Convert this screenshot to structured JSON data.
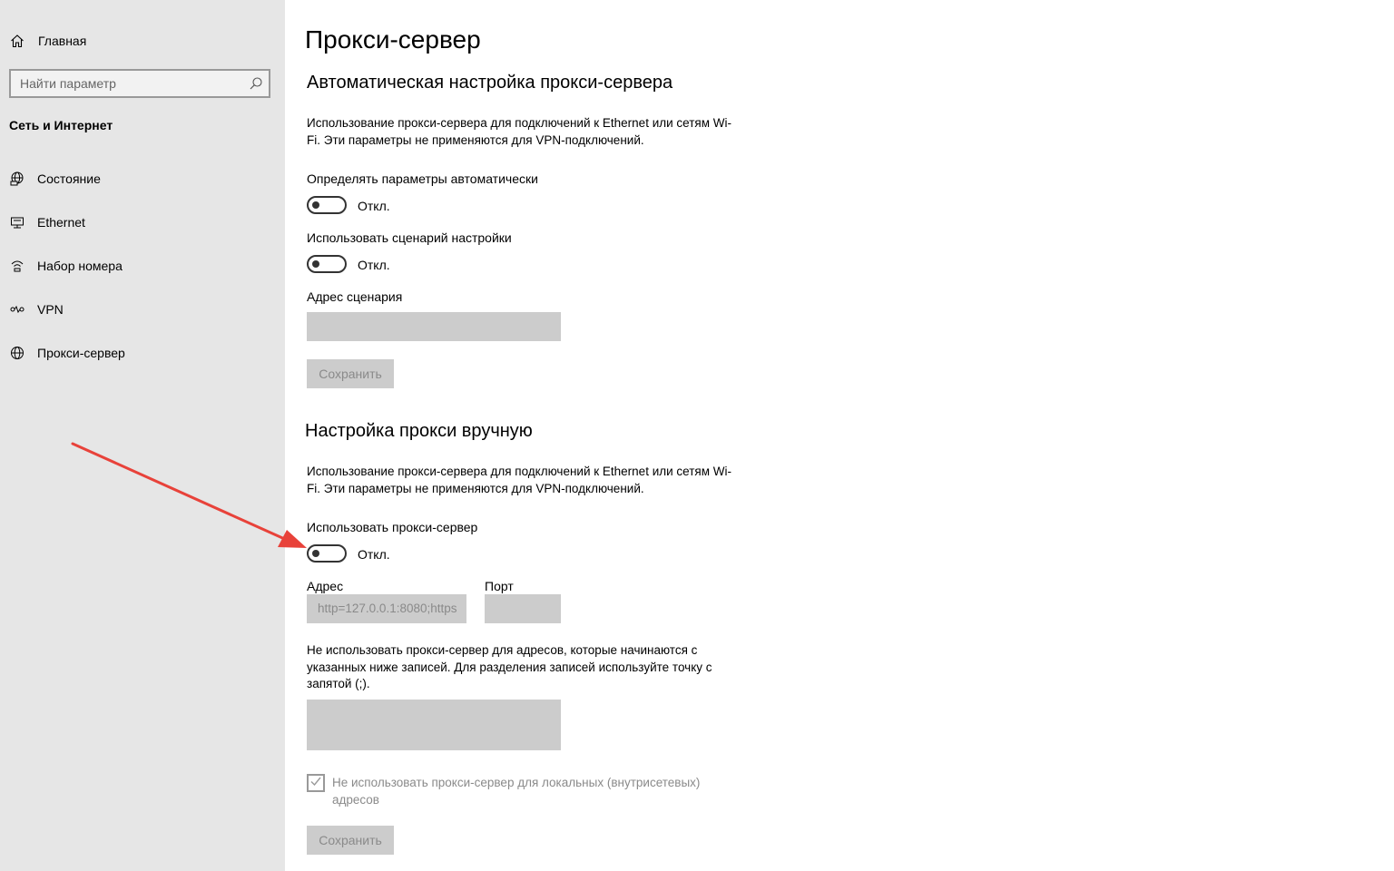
{
  "sidebar": {
    "home_label": "Главная",
    "search_placeholder": "Найти параметр",
    "section_title": "Сеть и Интернет",
    "items": [
      {
        "label": "Состояние",
        "icon": "globe-status-icon"
      },
      {
        "label": "Ethernet",
        "icon": "ethernet-icon"
      },
      {
        "label": "Набор номера",
        "icon": "dialup-icon"
      },
      {
        "label": "VPN",
        "icon": "vpn-icon"
      },
      {
        "label": "Прокси-сервер",
        "icon": "globe-icon"
      }
    ]
  },
  "main": {
    "title": "Прокси-сервер",
    "auto": {
      "heading": "Автоматическая настройка прокси-сервера",
      "description": "Использование прокси-сервера для подключений к Ethernet или сетям Wi-Fi. Эти параметры не применяются для VPN-подключений.",
      "detect_label": "Определять параметры автоматически",
      "detect_state": "Откл.",
      "detect_on": false,
      "script_label": "Использовать сценарий настройки",
      "script_state": "Откл.",
      "script_on": false,
      "address_label": "Адрес сценария",
      "address_value": "",
      "save_label": "Сохранить"
    },
    "manual": {
      "heading": "Настройка прокси вручную",
      "description": "Использование прокси-сервера для подключений к Ethernet или сетям Wi-Fi. Эти параметры не применяются для VPN-подключений.",
      "use_proxy_label": "Использовать прокси-сервер",
      "use_proxy_state": "Откл.",
      "use_proxy_on": false,
      "address_label": "Адрес",
      "address_value": "http=127.0.0.1:8080;https",
      "port_label": "Порт",
      "port_value": "",
      "exceptions_description": "Не использовать прокси-сервер для адресов, которые начинаются с указанных ниже записей. Для разделения записей используйте точку с запятой (;).",
      "exceptions_value": "",
      "local_bypass_label": "Не использовать прокси-сервер для локальных (внутрисетевых) адресов",
      "local_bypass_checked": true,
      "save_label": "Сохранить"
    }
  },
  "colors": {
    "sidebar_bg": "#e6e6e6",
    "disabled_field": "#cccccc",
    "annotation_arrow": "#e8423a"
  }
}
